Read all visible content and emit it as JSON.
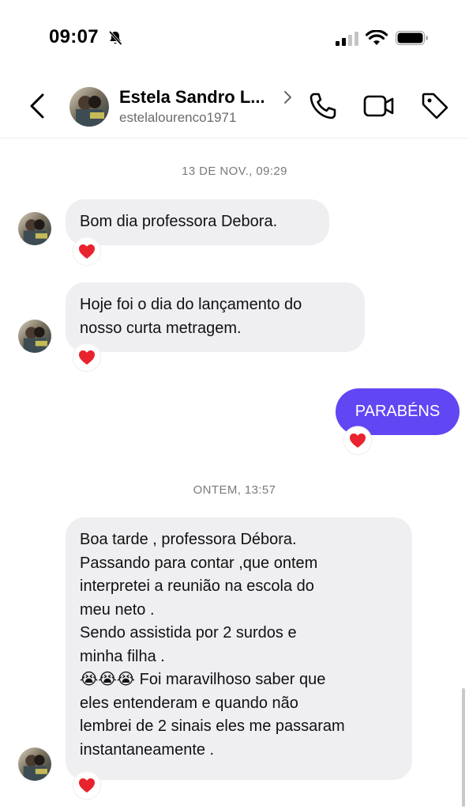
{
  "status_bar": {
    "time": "09:07"
  },
  "header": {
    "contact_name": "Estela Sandro L...",
    "username": "estelalourenco1971"
  },
  "conversation": {
    "timestamp_1": "13 DE NOV., 09:29",
    "message_1": "Bom dia professora Debora.",
    "message_2_lines": [
      "Hoje foi o dia do lançamento do",
      "nosso curta metragem."
    ],
    "sent_message": "PARABÉNS",
    "timestamp_2": "ONTEM, 13:57",
    "message_3_lines": [
      "Boa tarde , professora Débora.",
      "Passando para contar ,que ontem",
      "interpretei a reunião na escola do",
      "meu neto .",
      "Sendo assistida por 2 surdos e",
      "minha filha .",
      "😭😭😭 Foi maravilhoso saber que",
      "eles entenderam e quando não",
      "lembrei de 2 sinais eles me passaram",
      "instantaneamente ."
    ],
    "reaction": "heart"
  },
  "colors": {
    "sent_bubble": "#6146f3",
    "received_bubble": "#efeff2",
    "heart": "#e8232d"
  }
}
